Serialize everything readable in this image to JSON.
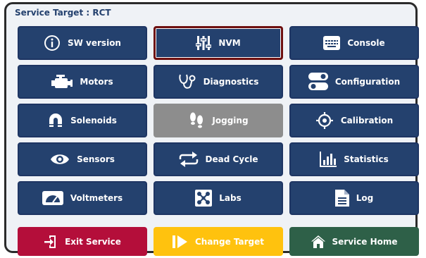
{
  "header": {
    "title": "Service Target : RCT"
  },
  "buttons": {
    "sw_version": "SW version",
    "nvm": "NVM",
    "console": "Console",
    "motors": "Motors",
    "diagnostics": "Diagnostics",
    "configuration": "Configuration",
    "solenoids": "Solenoids",
    "jogging": "Jogging",
    "calibration": "Calibration",
    "sensors": "Sensors",
    "dead_cycle": "Dead Cycle",
    "statistics": "Statistics",
    "voltmeters": "Voltmeters",
    "labs": "Labs",
    "log": "Log"
  },
  "footer": {
    "exit": "Exit Service",
    "change_target": "Change Target",
    "home": "Service Home"
  },
  "colors": {
    "primary": "#24416e",
    "selected_border": "#6e1010",
    "disabled": "#8d8d8d",
    "exit": "#b40e3a",
    "change_target": "#ffc20e",
    "home": "#2e6048"
  },
  "icons": {
    "sw_version": "info-icon",
    "nvm": "sliders-icon",
    "console": "keyboard-icon",
    "motors": "engine-icon",
    "diagnostics": "stethoscope-icon",
    "configuration": "toggles-icon",
    "solenoids": "magnet-icon",
    "jogging": "footprints-icon",
    "calibration": "crosshair-icon",
    "sensors": "eye-icon",
    "dead_cycle": "cycle-arrows-icon",
    "statistics": "bar-chart-icon",
    "voltmeters": "gauge-icon",
    "labs": "labs-icon",
    "log": "document-icon",
    "exit": "exit-icon",
    "change_target": "skip-icon",
    "home": "home-icon"
  }
}
